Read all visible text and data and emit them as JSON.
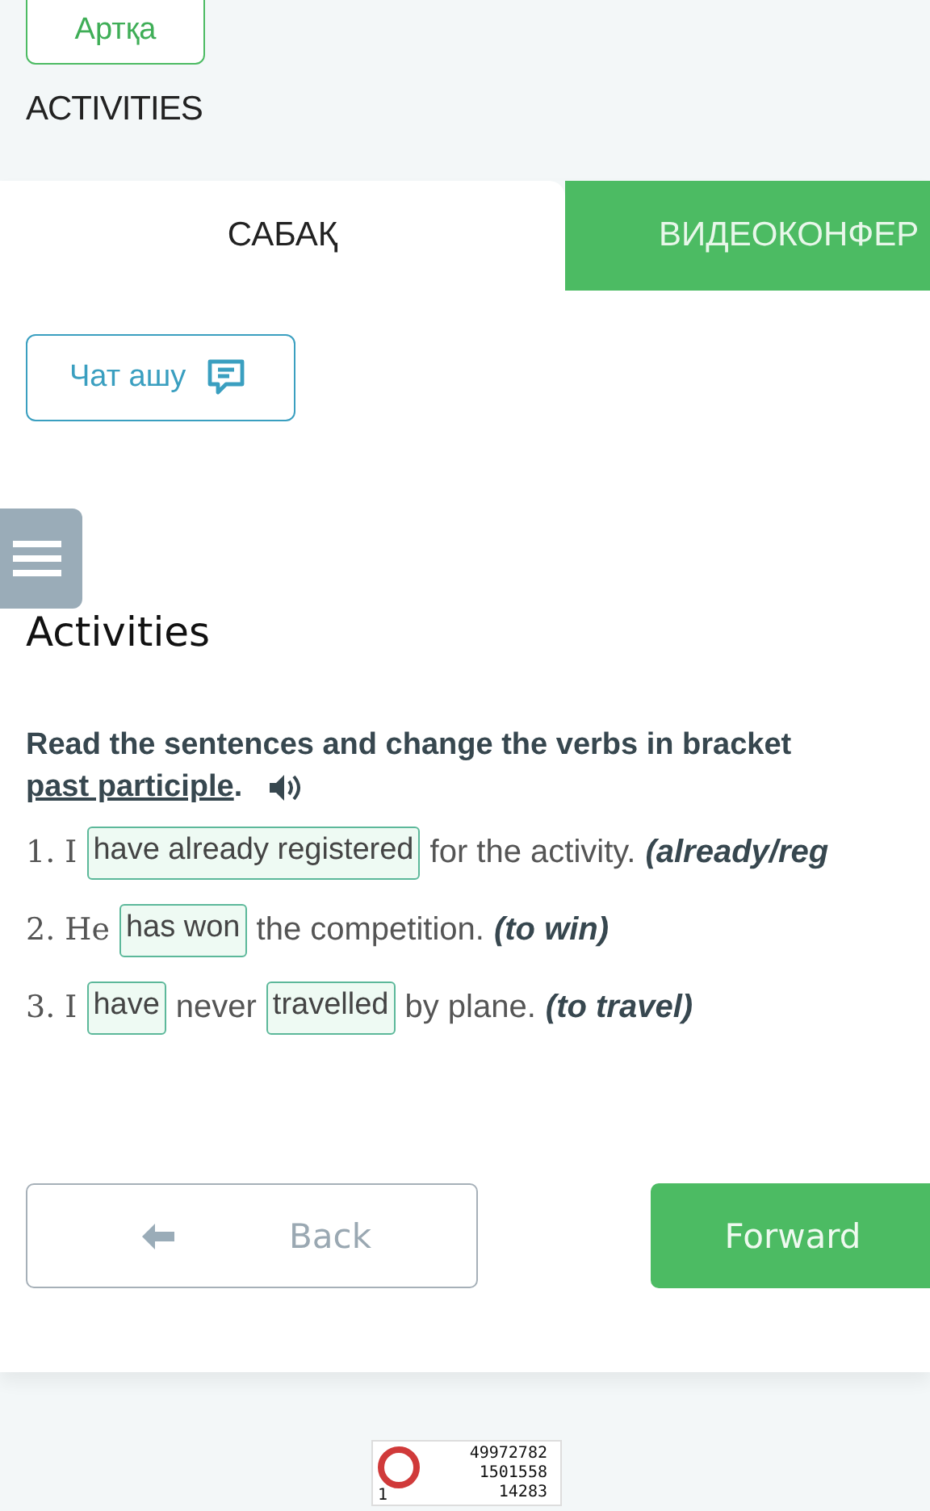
{
  "back_link": "Артқа",
  "section_title": "ACTIVITIES",
  "tabs": [
    {
      "label": "САБАҚ",
      "selected": true
    },
    {
      "label": "ВИДЕОКОНФЕР",
      "selected": false
    }
  ],
  "chat_button": "Чат ашу",
  "heading": "Activities",
  "instruction": {
    "line_1": "Read the sentences and change the verbs in bracket",
    "underlined": "past participle",
    "end": "."
  },
  "sentences": [
    {
      "parts": [
        {
          "kind": "number",
          "text": "1. I"
        },
        {
          "kind": "answer",
          "text": "have already registered"
        },
        {
          "kind": "text",
          "text": "for the activity."
        },
        {
          "kind": "hint",
          "text": "(already/reg"
        }
      ]
    },
    {
      "parts": [
        {
          "kind": "number",
          "text": "2. He"
        },
        {
          "kind": "answer",
          "text": "has won"
        },
        {
          "kind": "text",
          "text": "the competition."
        },
        {
          "kind": "hint",
          "text": "(to win)"
        }
      ]
    },
    {
      "parts": [
        {
          "kind": "number",
          "text": "3. I"
        },
        {
          "kind": "answer",
          "text": "have"
        },
        {
          "kind": "text",
          "text": "never"
        },
        {
          "kind": "answer",
          "text": "travelled"
        },
        {
          "kind": "text",
          "text": "by plane."
        },
        {
          "kind": "hint",
          "text": "(to travel)"
        }
      ]
    }
  ],
  "nav": {
    "back": "Back",
    "forward": "Forward"
  },
  "counter": {
    "corner": "1",
    "lines": [
      "49972782",
      "1501558",
      "14283"
    ]
  }
}
